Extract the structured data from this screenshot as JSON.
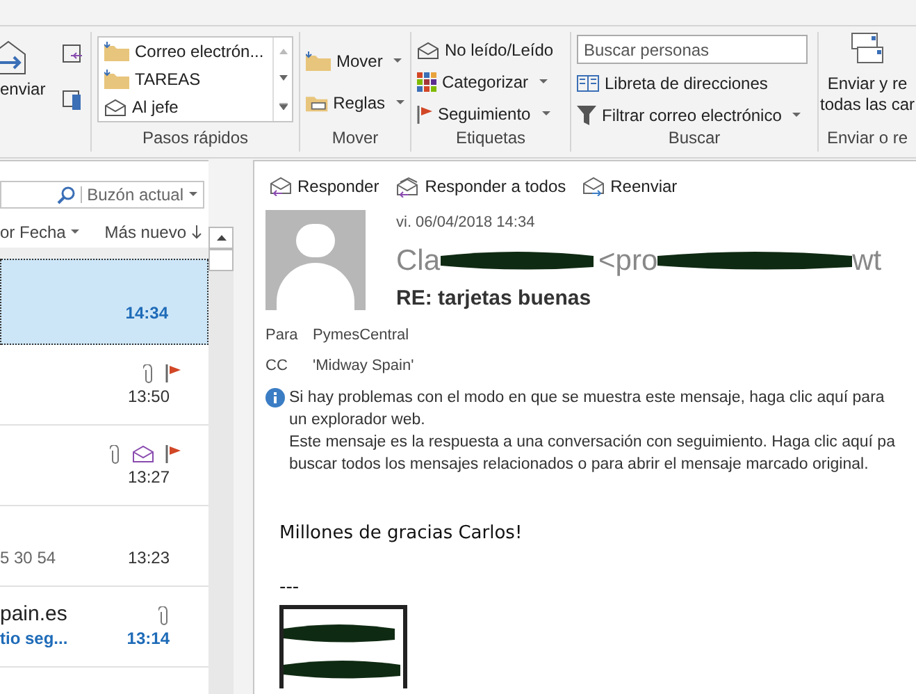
{
  "ribbon": {
    "respond_group": {
      "forward_label": "enviar"
    },
    "quick_steps": {
      "items": [
        {
          "label": "Correo electrón...",
          "kind": "folder"
        },
        {
          "label": "TAREAS",
          "kind": "folder"
        },
        {
          "label": "Al jefe",
          "kind": "mail"
        }
      ],
      "group_label": "Pasos rápidos"
    },
    "move": {
      "buttons": [
        {
          "label": "Mover",
          "kind": "move"
        },
        {
          "label": "Reglas",
          "kind": "rules"
        }
      ],
      "group_label": "Mover"
    },
    "tags": {
      "buttons": [
        {
          "label": "No leído/Leído",
          "kind": "read",
          "dropdown": false
        },
        {
          "label": "Categorizar",
          "kind": "categorize",
          "dropdown": true
        },
        {
          "label": "Seguimiento",
          "kind": "flag",
          "dropdown": true
        }
      ],
      "group_label": "Etiquetas"
    },
    "find": {
      "search_placeholder": "Buscar personas",
      "buttons": [
        {
          "label": "Libreta de direcciones",
          "kind": "book",
          "dropdown": false
        },
        {
          "label": "Filtrar correo electrónico",
          "kind": "filter",
          "dropdown": true
        }
      ],
      "group_label": "Buscar"
    },
    "send_receive": {
      "label_line_1": "Enviar y re",
      "label_line_2": "todas las car",
      "group_label": "Enviar o re"
    }
  },
  "mail_list": {
    "scope": "Buzón actual",
    "sort_by": "or Fecha",
    "order": "Más nuevo",
    "rows": [
      {
        "line_1": "",
        "line_2": "",
        "time": "14:34",
        "selected": true,
        "unread": true,
        "attachment": false,
        "replied": false,
        "flagged": false
      },
      {
        "line_1": "",
        "line_2": "",
        "time": "13:50",
        "selected": false,
        "unread": false,
        "attachment": true,
        "replied": false,
        "flagged": true
      },
      {
        "line_1": "",
        "line_2": "",
        "time": "13:27",
        "selected": false,
        "unread": false,
        "attachment": true,
        "replied": true,
        "flagged": true
      },
      {
        "line_1": "",
        "line_2": "5 30 54",
        "time": "13:23",
        "selected": false,
        "unread": false,
        "attachment": false,
        "replied": false,
        "flagged": false
      },
      {
        "line_1": "pain.es",
        "line_2": "tio seg...",
        "time": "13:14",
        "selected": false,
        "unread": true,
        "attachment": true,
        "replied": false,
        "flagged": false
      }
    ]
  },
  "reading_pane": {
    "actions": [
      {
        "label": "Responder",
        "kind": "reply"
      },
      {
        "label": "Responder a todos",
        "kind": "reply_all"
      },
      {
        "label": "Reenviar",
        "kind": "forward"
      }
    ],
    "date": "vi. 06/04/2018 14:34",
    "sender_parts": [
      "Cla",
      "<pro",
      "wt"
    ],
    "subject": "RE: tarjetas buenas",
    "recipients": [
      {
        "label": "Para",
        "value": "PymesCentral"
      },
      {
        "label": "CC",
        "value": "'Midway Spain'"
      }
    ],
    "info_lines": [
      "Si hay problemas con el modo en que se muestra este mensaje, haga clic aquí para",
      "un explorador web.",
      "Este mensaje es la respuesta a una conversación con seguimiento. Haga clic aquí pa",
      "buscar todos los mensajes relacionados o para abrir el mensaje marcado original."
    ],
    "body": [
      "Millones de gracias Carlos!",
      "---"
    ]
  }
}
